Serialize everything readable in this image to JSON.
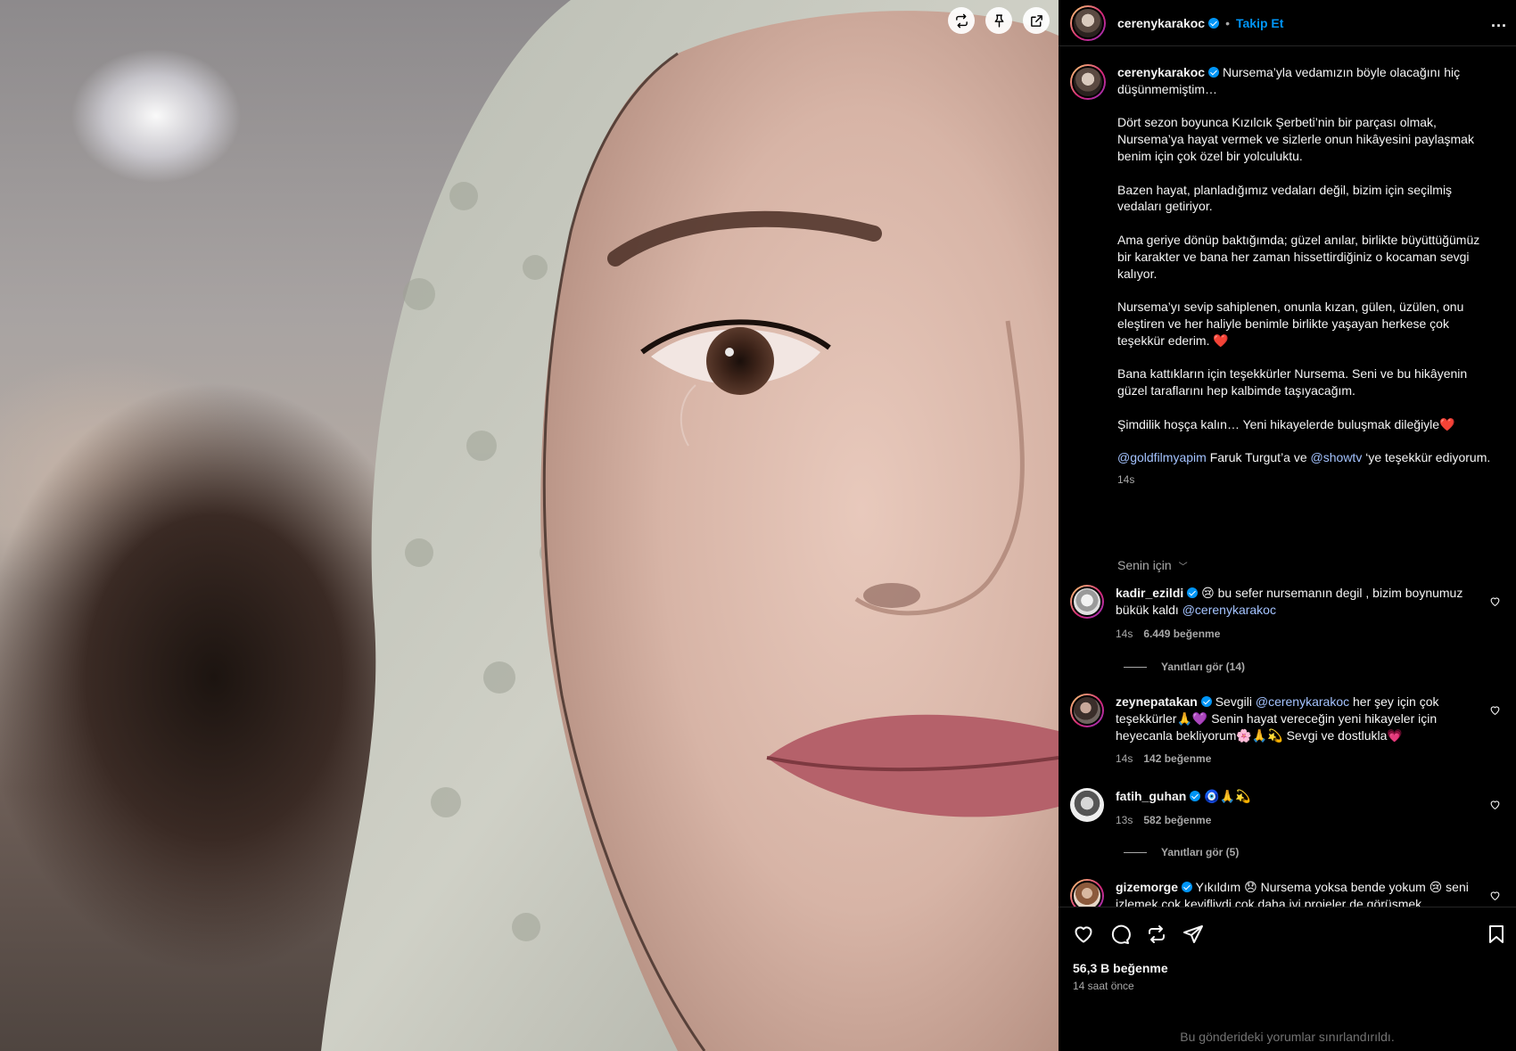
{
  "post": {
    "username": "cerenykarakoc",
    "follow_label": "Takip Et",
    "more_label": "...",
    "caption_first": " Nursema’yla vedamızın böyle olacağını hiç düşünmemiştim…",
    "caption_paragraphs": [
      "Dört sezon boyunca Kızılcık Şerbeti’nin bir parçası olmak, Nursema’ya hayat vermek ve sizlerle onun hikâyesini paylaşmak benim için çok özel bir yolculuktu.",
      "Bazen hayat, planladığımız vedaları değil, bizim için seçilmiş vedaları getiriyor.",
      "Ama geriye dönüp baktığımda; güzel anılar, birlikte büyüttüğümüz bir karakter ve bana her zaman hissettirdiğiniz o kocaman sevgi kalıyor.",
      "Nursema’yı sevip sahiplenen, onunla kızan, gülen, üzülen, onu eleştiren ve her haliyle benimle birlikte yaşayan herkese çok teşekkür ederim. ❤️",
      "Bana kattıkların için teşekkürler Nursema. Seni ve bu hikâyenin güzel taraflarını hep kalbimde taşıyacağım.",
      "Şimdilik hoşça kalın… Yeni hikayelerde buluşmak dileğiyle❤️"
    ],
    "last_mention_1": "@goldfilmyapim",
    "last_text_1": " Faruk Turgut’a ve ",
    "last_mention_2": "@showtv",
    "last_text_2": " ‘ye teşekkür ediyorum.",
    "caption_age": "14s",
    "sort_label": "Senin için",
    "likes": "56,3 B beğenme",
    "posted": "14 saat önce",
    "comments_limited": "Bu gönderideki yorumlar sınırlandırıldı."
  },
  "comments": [
    {
      "user": "kadir_ezildi",
      "text": " 😢 bu sefer nursemanın degil , bizim boynumuz bükük kaldı ",
      "mention": "@cerenykarakoc",
      "age": "14s",
      "likes": "6.449 beğenme",
      "replies": "Yanıtları gör (14)"
    },
    {
      "user": "zeynepatakan",
      "text_pre": " Sevgili ",
      "mention": "@cerenykarakoc",
      "text": " her şey için çok teşekkürler🙏💜 Senin hayat vereceğin yeni hikayeler için heyecanla bekliyorum🌸🙏💫 Sevgi ve dostlukla💗",
      "age": "14s",
      "likes": "142 beğenme"
    },
    {
      "user": "fatih_guhan",
      "text": " 🧿🙏💫",
      "age": "13s",
      "likes": "582 beğenme",
      "replies": "Yanıtları gör (5)"
    },
    {
      "user": "gizemorge",
      "text": " Yıkıldım 😞 Nursema yoksa bende yokum 😢 seni izlemek çok keyifliydi çok daha iyi projeler de görüşmek"
    }
  ],
  "icons": {
    "media_tools": [
      "repost-icon",
      "pin-icon",
      "share-external-icon"
    ],
    "actions": [
      "heart-icon",
      "comment-icon",
      "repost-icon",
      "send-icon",
      "bookmark-icon"
    ]
  },
  "colors": {
    "accent": "#0095f6",
    "panel_bg": "#000000",
    "muted": "#a8a8a8"
  }
}
